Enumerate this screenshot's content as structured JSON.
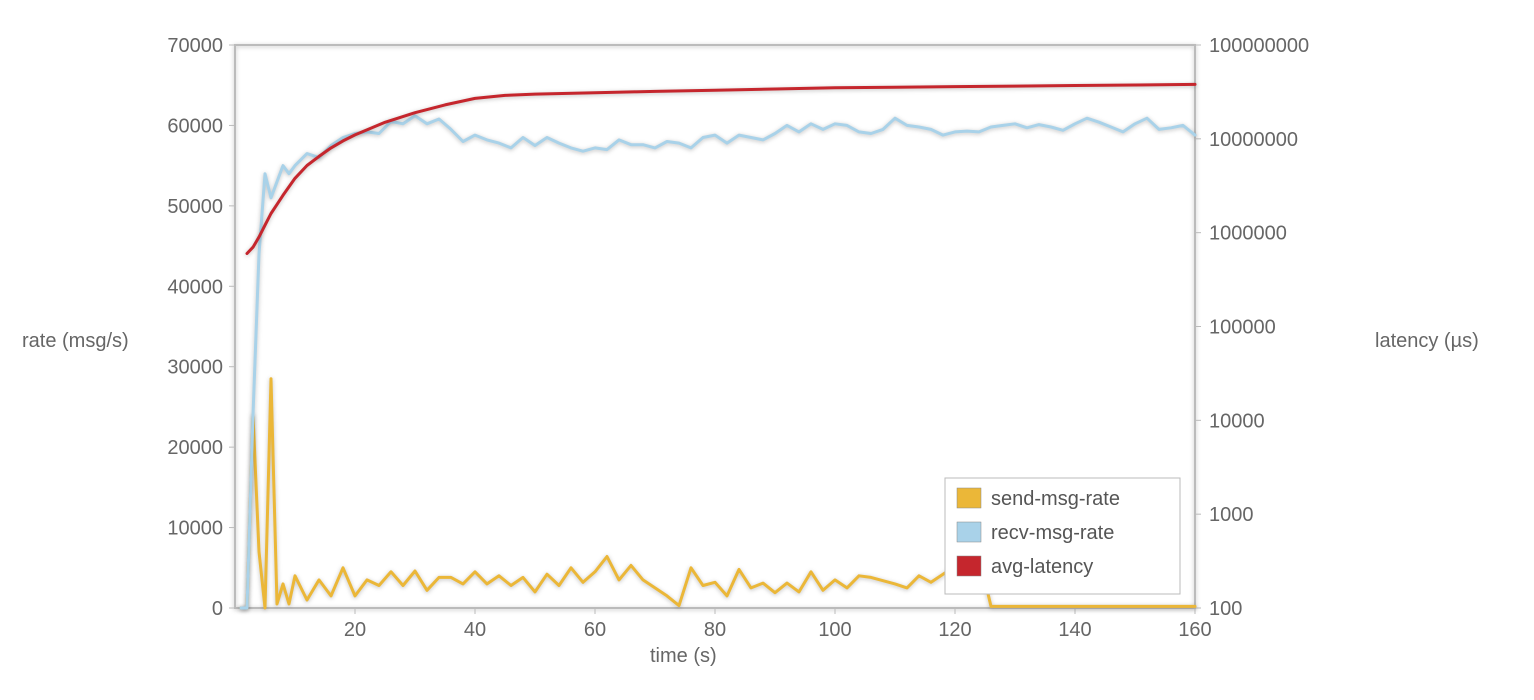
{
  "chart_data": {
    "type": "line",
    "xlabel": "time (s)",
    "ylabel_left": "rate (msg/s)",
    "ylabel_right": "latency (µs)",
    "x": {
      "min": 0,
      "max": 160,
      "ticks": [
        20,
        40,
        60,
        80,
        100,
        120,
        140,
        160
      ]
    },
    "y_left": {
      "min": 0,
      "max": 70000,
      "ticks": [
        0,
        10000,
        20000,
        30000,
        40000,
        50000,
        60000,
        70000
      ]
    },
    "y_right": {
      "type": "log",
      "min": 100,
      "max": 100000000,
      "ticks": [
        100,
        1000,
        10000,
        100000,
        1000000,
        10000000,
        100000000
      ]
    },
    "colors": {
      "send": "#ebb738",
      "recv": "#a9d2e9",
      "latency": "#c5262d"
    },
    "legend": [
      {
        "key": "send",
        "label": "send-msg-rate",
        "color": "#ebb738"
      },
      {
        "key": "recv",
        "label": "recv-msg-rate",
        "color": "#a9d2e9"
      },
      {
        "key": "latency",
        "label": "avg-latency",
        "color": "#c5262d"
      }
    ],
    "series": [
      {
        "name": "send-msg-rate",
        "axis": "left",
        "color": "#ebb738",
        "x": [
          1,
          2,
          3,
          4,
          5,
          6,
          7,
          8,
          9,
          10,
          12,
          14,
          16,
          18,
          20,
          22,
          24,
          26,
          28,
          30,
          32,
          34,
          36,
          38,
          40,
          42,
          44,
          46,
          48,
          50,
          52,
          54,
          56,
          58,
          60,
          62,
          64,
          66,
          68,
          70,
          72,
          74,
          76,
          78,
          80,
          82,
          84,
          86,
          88,
          90,
          92,
          94,
          96,
          98,
          100,
          102,
          104,
          106,
          108,
          110,
          112,
          114,
          116,
          118,
          120,
          122,
          124,
          126,
          130,
          140,
          150,
          160
        ],
        "y": [
          0,
          0,
          24000,
          7000,
          0,
          28500,
          500,
          3000,
          500,
          4000,
          1000,
          3500,
          1500,
          5000,
          1500,
          3500,
          2800,
          4500,
          2800,
          4600,
          2200,
          3800,
          3800,
          3000,
          4500,
          3000,
          4000,
          2800,
          3800,
          2000,
          4200,
          2800,
          5000,
          3200,
          4500,
          6400,
          3500,
          5300,
          3500,
          2500,
          1500,
          300,
          5000,
          2800,
          3200,
          1500,
          4800,
          2500,
          3100,
          1900,
          3100,
          2000,
          4500,
          2200,
          3500,
          2500,
          4000,
          3800,
          3400,
          3000,
          2500,
          4000,
          3200,
          4200,
          5200,
          2800,
          6500,
          200,
          200,
          200,
          200,
          200
        ]
      },
      {
        "name": "recv-msg-rate",
        "axis": "left",
        "color": "#a9d2e9",
        "x": [
          1,
          2,
          3,
          4,
          5,
          6,
          7,
          8,
          9,
          10,
          12,
          14,
          16,
          18,
          20,
          22,
          24,
          26,
          28,
          30,
          32,
          34,
          36,
          38,
          40,
          42,
          44,
          46,
          48,
          50,
          52,
          54,
          56,
          58,
          60,
          62,
          64,
          66,
          68,
          70,
          72,
          74,
          76,
          78,
          80,
          82,
          84,
          86,
          88,
          90,
          92,
          94,
          96,
          98,
          100,
          102,
          104,
          106,
          108,
          110,
          112,
          114,
          116,
          118,
          120,
          122,
          124,
          126,
          128,
          130,
          132,
          134,
          136,
          138,
          140,
          142,
          144,
          146,
          148,
          150,
          152,
          154,
          156,
          158,
          160
        ],
        "y": [
          0,
          0,
          24000,
          44000,
          54000,
          51000,
          53000,
          55000,
          54000,
          55000,
          56500,
          56000,
          57500,
          58500,
          59000,
          59200,
          59000,
          60500,
          60200,
          61200,
          60200,
          60800,
          59500,
          58000,
          58800,
          58200,
          57800,
          57200,
          58500,
          57500,
          58500,
          57800,
          57200,
          56800,
          57200,
          57000,
          58200,
          57600,
          57600,
          57200,
          58000,
          57800,
          57200,
          58500,
          58800,
          57800,
          58800,
          58500,
          58200,
          59000,
          60000,
          59200,
          60200,
          59500,
          60200,
          60000,
          59200,
          59000,
          59500,
          60900,
          60000,
          59800,
          59500,
          58800,
          59200,
          59300,
          59200,
          59800,
          60000,
          60200,
          59700,
          60100,
          59800,
          59400,
          60200,
          60900,
          60400,
          59800,
          59200,
          60200,
          60900,
          59500,
          59700,
          60000,
          58800
        ]
      },
      {
        "name": "avg-latency",
        "axis": "right",
        "color": "#c5262d",
        "x": [
          2,
          3,
          4,
          5,
          6,
          7,
          8,
          10,
          12,
          14,
          16,
          18,
          20,
          25,
          30,
          35,
          40,
          45,
          50,
          60,
          70,
          80,
          90,
          100,
          110,
          120,
          130,
          140,
          150,
          160
        ],
        "y": [
          600000,
          700000,
          900000,
          1200000,
          1600000,
          2000000,
          2500000,
          3800000,
          5200000,
          6500000,
          8000000,
          9500000,
          11000000,
          15000000,
          19000000,
          23000000,
          27000000,
          29000000,
          30000000,
          31000000,
          32000000,
          33000000,
          34000000,
          35000000,
          35500000,
          36000000,
          36500000,
          37000000,
          37500000,
          38000000
        ]
      }
    ]
  }
}
